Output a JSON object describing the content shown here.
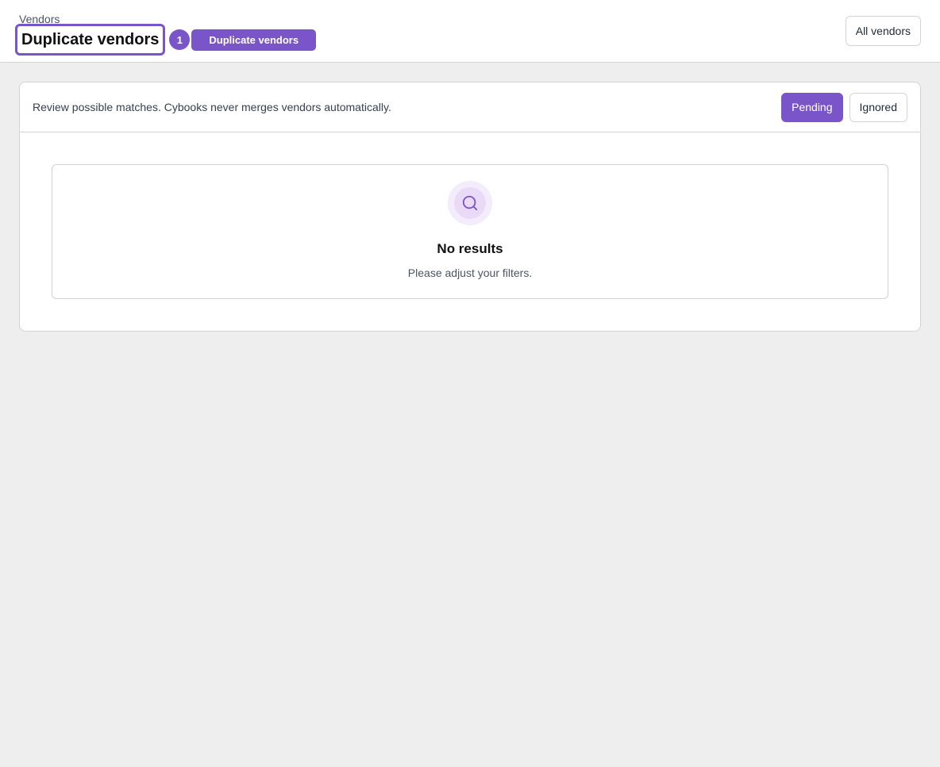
{
  "header": {
    "breadcrumb": "Vendors",
    "title": "Duplicate vendors",
    "step_number": "1",
    "step_label": "Duplicate vendors",
    "all_vendors_label": "All vendors"
  },
  "panel": {
    "description": "Review possible matches. Cybooks never merges vendors automatically.",
    "filters": [
      {
        "label": "Pending",
        "active": true
      },
      {
        "label": "Ignored",
        "active": false
      }
    ]
  },
  "empty_state": {
    "icon": "search-icon",
    "title": "No results",
    "subtitle": "Please adjust your filters."
  },
  "colors": {
    "accent": "#7a55c9",
    "background": "#eeeeee",
    "icon_bg": "#f3ecfa"
  }
}
